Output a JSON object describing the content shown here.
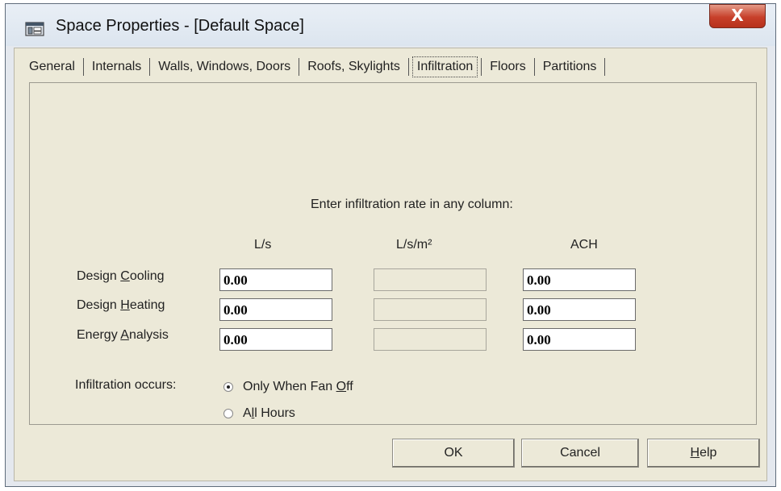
{
  "window": {
    "title": "Space Properties - [Default Space]",
    "icon": "app-window-icon",
    "close_glyph": "X"
  },
  "tabs": [
    {
      "label": "General",
      "active": false
    },
    {
      "label": "Internals",
      "active": false
    },
    {
      "label": "Walls, Windows, Doors",
      "active": false
    },
    {
      "label": "Roofs, Skylights",
      "active": false
    },
    {
      "label": "Infiltration",
      "active": true
    },
    {
      "label": "Floors",
      "active": false
    },
    {
      "label": "Partitions",
      "active": false
    }
  ],
  "panel": {
    "instruction": "Enter infiltration rate in any column:",
    "columns": [
      "L/s",
      "L/s/m²",
      "ACH"
    ],
    "rows": [
      {
        "label_pre": "Design ",
        "label_accel": "C",
        "label_post": "ooling",
        "ls": "0.00",
        "lsm2": "",
        "ach": "0.00"
      },
      {
        "label_pre": "Design ",
        "label_accel": "H",
        "label_post": "eating",
        "ls": "0.00",
        "lsm2": "",
        "ach": "0.00"
      },
      {
        "label_pre": "Energy ",
        "label_accel": "A",
        "label_post": "nalysis",
        "ls": "0.00",
        "lsm2": "",
        "ach": "0.00"
      }
    ],
    "occurs_label": "Infiltration occurs:",
    "radio_options": [
      {
        "pre": "Only When Fan ",
        "accel": "O",
        "post": "ff",
        "checked": true
      },
      {
        "pre": "A",
        "accel": "l",
        "post": "l Hours",
        "checked": false
      }
    ]
  },
  "buttons": {
    "ok": "OK",
    "cancel": "Cancel",
    "help_accel": "H",
    "help_post": "elp"
  }
}
